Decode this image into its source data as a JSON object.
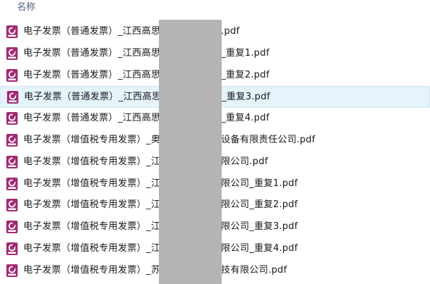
{
  "header": {
    "name_label": "名称",
    "sort_indicator": "^"
  },
  "icon": {
    "name": "pdf-file-icon",
    "color": "#a22b72",
    "label": "PDF"
  },
  "files": [
    {
      "name": "电子发票（普通发票）_江西高思",
      "suffix": ".pdf"
    },
    {
      "name": "电子发票（普通发票）_江西高思",
      "suffix": "_重复1.pdf"
    },
    {
      "name": "电子发票（普通发票）_江西高思",
      "suffix": "_重复2.pdf"
    },
    {
      "name": "电子发票（普通发票）_江西高思",
      "suffix": "_重复3.pdf",
      "selected": true
    },
    {
      "name": "电子发票（普通发票）_江西高思",
      "suffix": "_重复4.pdf"
    },
    {
      "name": "电子发票（增值税专用发票）_奥",
      "suffix": "设备有限责任公司.pdf"
    },
    {
      "name": "电子发票（增值税专用发票）_江",
      "suffix": "限公司.pdf"
    },
    {
      "name": "电子发票（增值税专用发票）_江",
      "suffix": "限公司_重复1.pdf"
    },
    {
      "name": "电子发票（增值税专用发票）_江",
      "suffix": "限公司_重复2.pdf"
    },
    {
      "name": "电子发票（增值税专用发票）_江",
      "suffix": "限公司_重复3.pdf"
    },
    {
      "name": "电子发票（增值税专用发票）_江",
      "suffix": "限公司_重复4.pdf"
    },
    {
      "name": "电子发票（增值税专用发票）_苏",
      "suffix": "技有限公司.pdf"
    }
  ]
}
